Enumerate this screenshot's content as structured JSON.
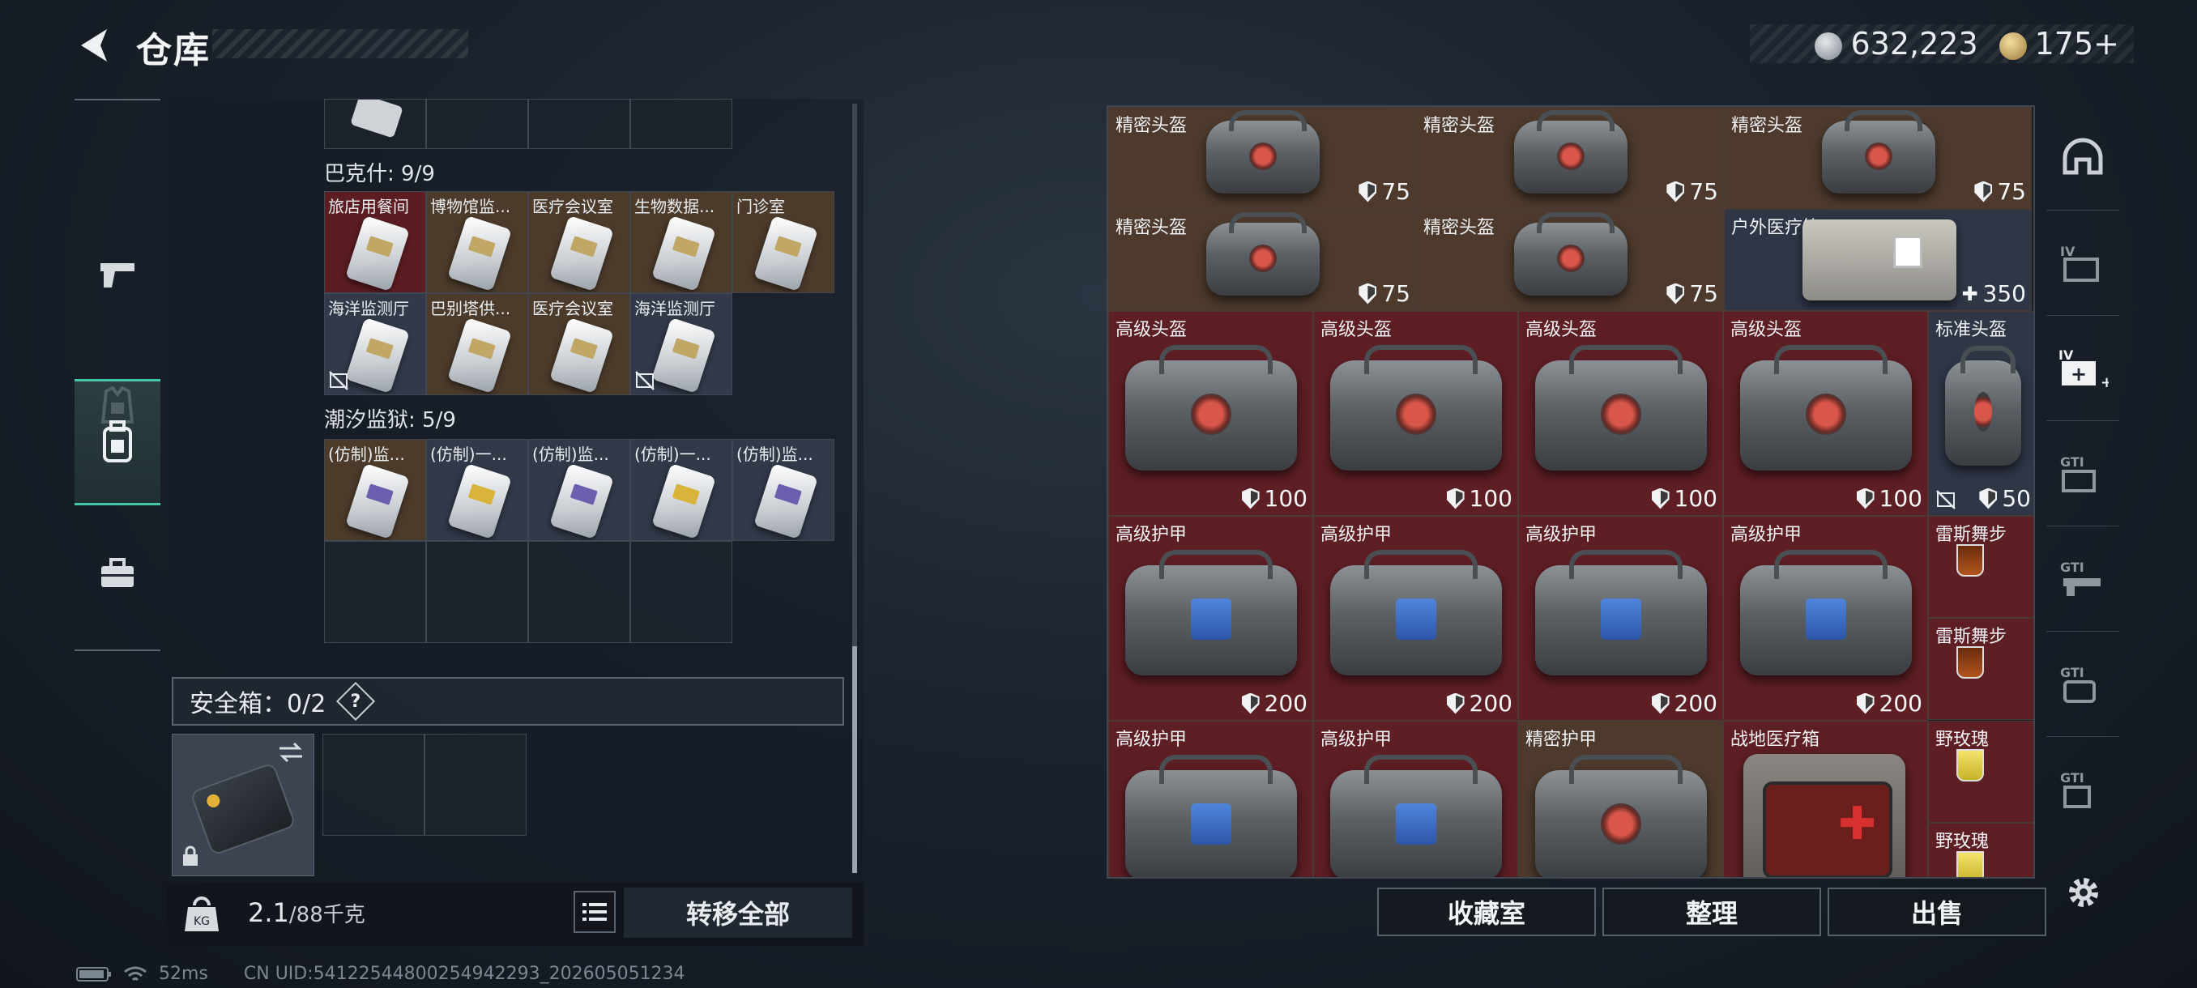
{
  "header": {
    "title": "仓库",
    "silver_amount": "632,223",
    "gold_amount": "175+"
  },
  "backpack": {
    "group1": {
      "label": "巴克什: 9/9",
      "items": [
        {
          "name": "旅店用餐间",
          "bg": "red",
          "no": false
        },
        {
          "name": "博物馆监...",
          "bg": "brown",
          "no": false
        },
        {
          "name": "医疗会议室",
          "bg": "brown",
          "no": false
        },
        {
          "name": "生物数据...",
          "bg": "brown",
          "no": false
        },
        {
          "name": "门诊室",
          "bg": "brown",
          "no": false
        },
        {
          "name": "海洋监测厅",
          "bg": "slate",
          "no": true
        },
        {
          "name": "巴别塔供...",
          "bg": "brown",
          "no": false
        },
        {
          "name": "医疗会议室",
          "bg": "brown",
          "no": false
        },
        {
          "name": "海洋监测厅",
          "bg": "slate",
          "no": true
        }
      ]
    },
    "group2": {
      "label": "潮汐监狱: 5/9",
      "items": [
        {
          "name": "(仿制)监...",
          "bg": "brown",
          "color": "purple"
        },
        {
          "name": "(仿制)一...",
          "bg": "slate",
          "color": "yellow"
        },
        {
          "name": "(仿制)监...",
          "bg": "slate",
          "color": "purple"
        },
        {
          "name": "(仿制)一...",
          "bg": "slate",
          "color": "yellow"
        },
        {
          "name": "(仿制)监...",
          "bg": "slate",
          "color": "purple"
        }
      ]
    }
  },
  "safebox": {
    "label": "安全箱：0/2",
    "help": "?"
  },
  "footer_left": {
    "weight_value": "2.1",
    "weight_max": "/88千克",
    "transfer_all": "转移全部"
  },
  "status": {
    "ping": "52ms",
    "uid": "CN UID:541225448002549422​93_202605051234"
  },
  "stash": {
    "row1": [
      {
        "name": "精密头盔",
        "value": "75"
      },
      {
        "name": "精密头盔",
        "value": "75"
      },
      {
        "name": "精密头盔",
        "value": "75"
      }
    ],
    "row2": [
      {
        "name": "精密头盔",
        "value": "75"
      },
      {
        "name": "精密头盔",
        "value": "75"
      },
      {
        "name": "户外医疗箱",
        "value": "350"
      }
    ],
    "row3": [
      {
        "name": "高级头盔",
        "value": "100"
      },
      {
        "name": "高级头盔",
        "value": "100"
      },
      {
        "name": "高级头盔",
        "value": "100"
      },
      {
        "name": "高级头盔",
        "value": "100"
      },
      {
        "name": "标准头盔",
        "value": "50"
      }
    ],
    "row4": [
      {
        "name": "高级护甲",
        "value": "200"
      },
      {
        "name": "高级护甲",
        "value": "200"
      },
      {
        "name": "高级护甲",
        "value": "200"
      },
      {
        "name": "高级护甲",
        "value": "200"
      }
    ],
    "row4_side": [
      {
        "name": "雷斯舞步"
      },
      {
        "name": "雷斯舞步"
      }
    ],
    "row5": [
      {
        "name": "高级护甲"
      },
      {
        "name": "高级护甲"
      },
      {
        "name": "精密护甲"
      },
      {
        "name": "战地医疗箱"
      }
    ],
    "row5_side": [
      {
        "name": "野玫瑰"
      },
      {
        "name": "野玫瑰"
      }
    ]
  },
  "actions": {
    "collection": "收藏室",
    "sort": "整理",
    "sell": "出售"
  }
}
